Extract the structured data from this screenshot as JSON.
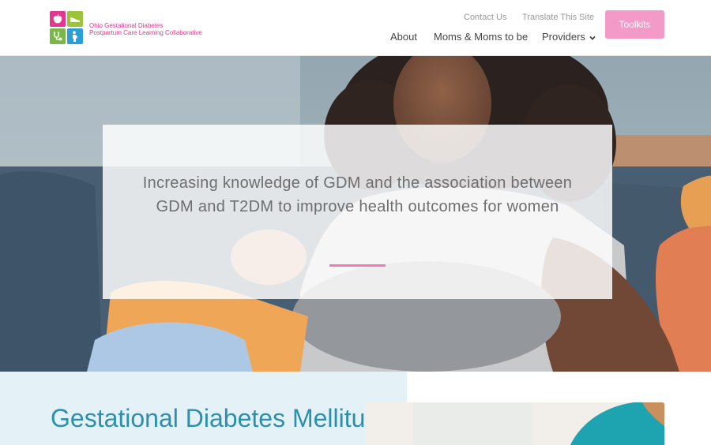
{
  "header": {
    "logo": {
      "line1": "Ohio Gestational Diabetes",
      "line2": "Postpartum Care Learning Collaborative"
    },
    "utility_links": [
      "Contact Us",
      "Translate This Site"
    ],
    "nav": [
      "About",
      "Moms & Moms to be",
      "Providers"
    ],
    "cta_label": "Toolkits"
  },
  "hero": {
    "tagline": "Increasing knowledge of GDM and the association between GDM and T2DM to improve health outcomes for women"
  },
  "section": {
    "title": "Gestational Diabetes Mellitus"
  },
  "colors": {
    "brand_pink": "#e2368f",
    "button_pink": "#f49ac8",
    "accent_line": "#f07ab2",
    "heading_teal": "#2c8fae",
    "section_bg": "#e4f2f7"
  },
  "icons": [
    "apple-icon",
    "shoe-icon",
    "stethoscope-icon",
    "pregnant-woman-icon",
    "chevron-down-icon"
  ]
}
